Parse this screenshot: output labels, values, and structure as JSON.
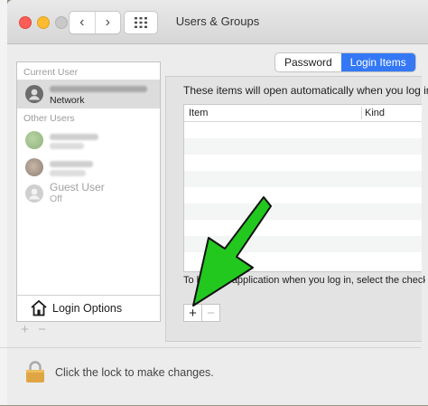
{
  "window": {
    "title": "Users & Groups"
  },
  "tabs": [
    {
      "label": "Password",
      "active": false
    },
    {
      "label": "Login Items",
      "active": true
    }
  ],
  "sidebar": {
    "current_user_label": "Current User",
    "current_user_sub": "Network",
    "other_users_label": "Other Users",
    "guest_name": "Guest User",
    "guest_sub": "Off",
    "login_options_label": "Login Options"
  },
  "main": {
    "description": "These items will open automatically when you log in:",
    "columns": [
      "Item",
      "Kind"
    ],
    "hint": "To hide an application when you log in, select the checkbox in the Hide column next to the application.",
    "add_label": "+",
    "remove_label": "−"
  },
  "footer": {
    "lock_text": "Click the lock to make changes."
  },
  "colors": {
    "accent": "#3478f6",
    "arrow": "#22c81e"
  },
  "icons": [
    "back-chevron-icon",
    "forward-chevron-icon",
    "grid-icon",
    "user-avatar-icon",
    "house-icon",
    "lock-icon",
    "green-arrow-icon"
  ]
}
